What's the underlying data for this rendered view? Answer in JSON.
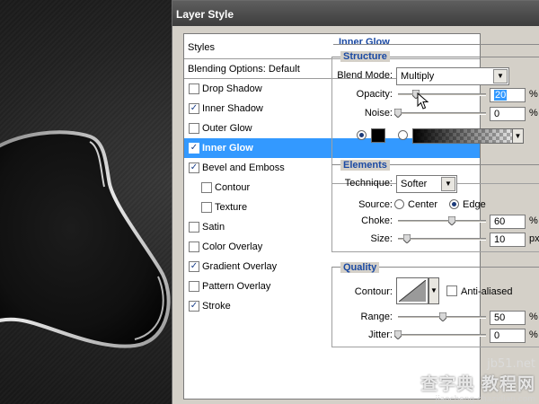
{
  "dialog": {
    "title": "Layer Style"
  },
  "styles_list": {
    "header": "Styles",
    "items": [
      {
        "label": "Blending Options: Default",
        "checked": null
      },
      {
        "label": "Drop Shadow",
        "checked": false
      },
      {
        "label": "Inner Shadow",
        "checked": true
      },
      {
        "label": "Outer Glow",
        "checked": false
      },
      {
        "label": "Inner Glow",
        "checked": true,
        "selected": true
      },
      {
        "label": "Bevel and Emboss",
        "checked": true
      },
      {
        "label": "Contour",
        "checked": false,
        "sub": true
      },
      {
        "label": "Texture",
        "checked": false,
        "sub": true
      },
      {
        "label": "Satin",
        "checked": false
      },
      {
        "label": "Color Overlay",
        "checked": false
      },
      {
        "label": "Gradient Overlay",
        "checked": true
      },
      {
        "label": "Pattern Overlay",
        "checked": false
      },
      {
        "label": "Stroke",
        "checked": true
      }
    ]
  },
  "panel": {
    "title": "Inner Glow",
    "structure": {
      "title": "Structure",
      "blend_mode_label": "Blend Mode:",
      "blend_mode_value": "Multiply",
      "opacity_label": "Opacity:",
      "opacity_value": "20",
      "noise_label": "Noise:",
      "noise_value": "0",
      "unit": "%",
      "color_swatch": "#000000",
      "color_radio_selected": true,
      "gradient_radio_selected": false
    },
    "elements": {
      "title": "Elements",
      "technique_label": "Technique:",
      "technique_value": "Softer",
      "source_label": "Source:",
      "source_center": "Center",
      "source_edge": "Edge",
      "source_selected": "Edge",
      "choke_label": "Choke:",
      "choke_value": "60",
      "size_label": "Size:",
      "size_value": "10",
      "unit_pct": "%",
      "unit_px": "px"
    },
    "quality": {
      "title": "Quality",
      "contour_label": "Contour:",
      "anti_aliased_label": "Anti-aliased",
      "anti_aliased_checked": false,
      "range_label": "Range:",
      "range_value": "50",
      "jitter_label": "Jitter:",
      "jitter_value": "0",
      "unit": "%"
    }
  },
  "watermark": {
    "line1": "jb51.net",
    "line2": "查字典 教程网",
    "line3": "jiaocheng.chazidian.com"
  },
  "icons": [
    "checkmark-icon",
    "dropdown-arrow-icon",
    "slider-thumb-icon",
    "mouse-cursor-icon"
  ]
}
